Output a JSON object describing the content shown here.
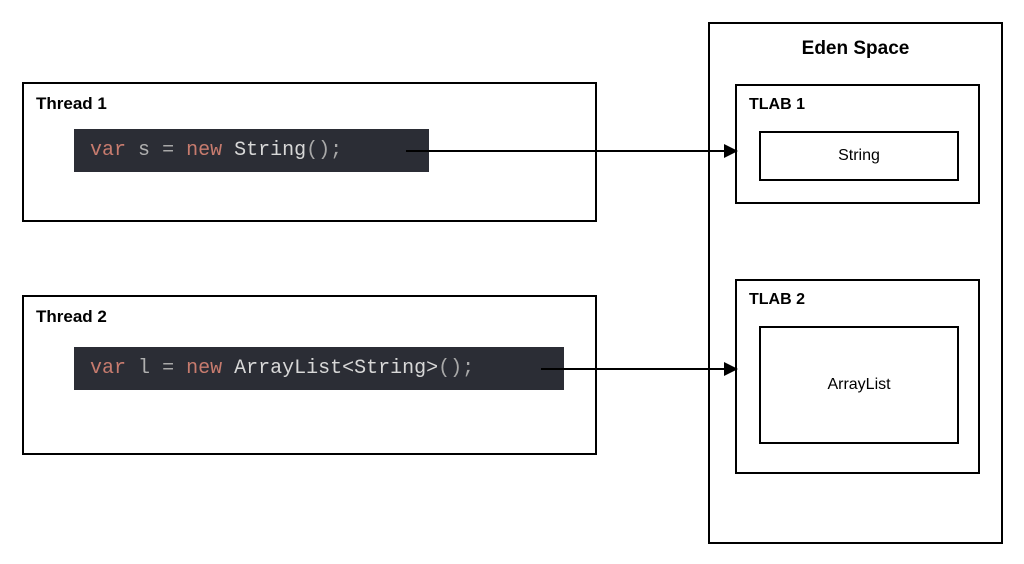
{
  "threads": {
    "thread1": {
      "label": "Thread 1",
      "code": {
        "var_keyword": "var",
        "var_name": "s",
        "equals": "=",
        "new_keyword": "new",
        "type": "String",
        "parens_semi": "();"
      }
    },
    "thread2": {
      "label": "Thread 2",
      "code": {
        "var_keyword": "var",
        "var_name": "l",
        "equals": "=",
        "new_keyword": "new",
        "type": "ArrayList<String>",
        "parens_semi": "();"
      }
    }
  },
  "eden": {
    "label": "Eden Space",
    "tlab1": {
      "label": "TLAB 1",
      "object": "String"
    },
    "tlab2": {
      "label": "TLAB 2",
      "object": "ArrayList"
    }
  }
}
